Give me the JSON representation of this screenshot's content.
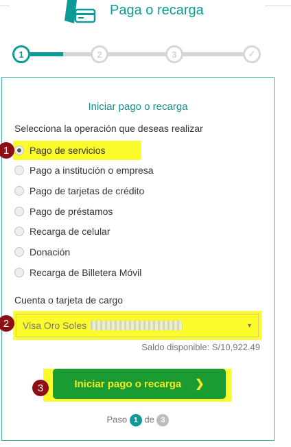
{
  "header": {
    "title": "Paga o recarga",
    "icon": "payment-card-icon"
  },
  "stepper": {
    "steps": [
      {
        "label": "1",
        "state": "active"
      },
      {
        "label": "2",
        "state": "pending"
      },
      {
        "label": "3",
        "state": "pending"
      },
      {
        "label": "✓",
        "state": "pending"
      }
    ],
    "progress": 0.5
  },
  "form": {
    "title": "Iniciar pago o recarga",
    "prompt": "Selecciona la operación que deseas realizar",
    "options": [
      {
        "label": "Pago de servicios",
        "checked": true
      },
      {
        "label": "Pago a institución o empresa",
        "checked": false
      },
      {
        "label": "Pago de tarjetas de crédito",
        "checked": false
      },
      {
        "label": "Pago de préstamos",
        "checked": false
      },
      {
        "label": "Recarga de celular",
        "checked": false
      },
      {
        "label": "Donación",
        "checked": false
      },
      {
        "label": "Recarga de Billetera Móvil",
        "checked": false
      }
    ],
    "account_label": "Cuenta o tarjeta de cargo",
    "account_value": "Visa Oro Soles",
    "balance": "Saldo disponible: S/10,922.49",
    "submit_label": "Iniciar pago o recarga",
    "submit_arrow": "❯",
    "footer": {
      "prefix": "Paso",
      "current": "1",
      "middle": "de",
      "total": "3"
    }
  },
  "annotations": [
    "1",
    "2",
    "3"
  ],
  "colors": {
    "accent": "#0d9a98",
    "highlight": "#fbfb2c",
    "button": "#1a9c32",
    "badge": "#8b0f14"
  }
}
